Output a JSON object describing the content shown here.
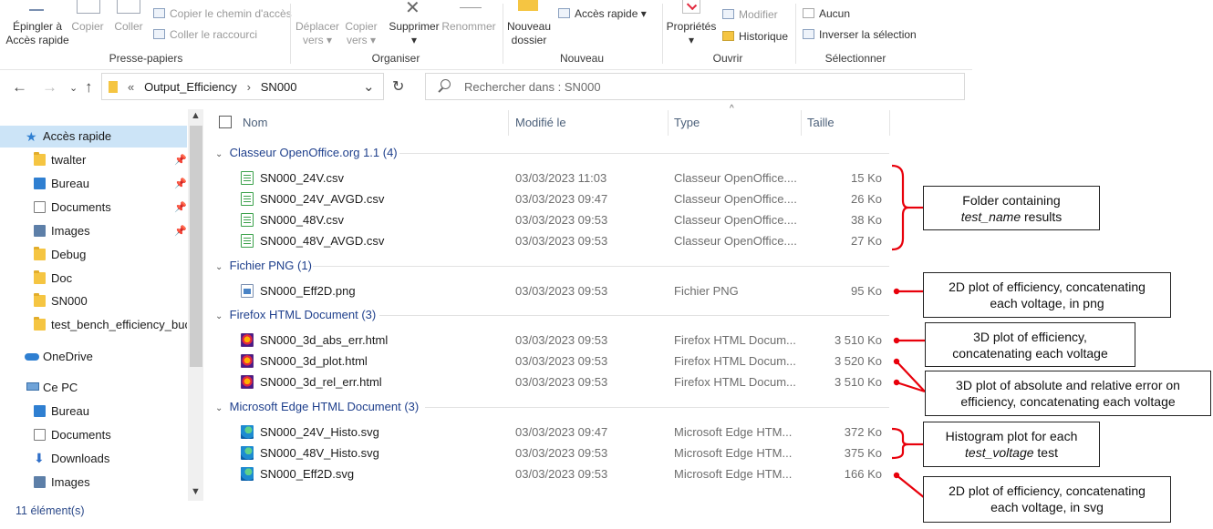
{
  "ribbon": {
    "clipboard": {
      "pin_label_1": "Épingler à",
      "pin_label_2": "Accès rapide",
      "copy": "Copier",
      "paste": "Coller",
      "copy_path": "Copier le chemin d'accès",
      "paste_shortcut": "Coller le raccourci",
      "group": "Presse-papiers"
    },
    "organize": {
      "move_1": "Déplacer",
      "move_2": "vers",
      "copy_1": "Copier",
      "copy_2": "vers",
      "delete": "Supprimer",
      "rename": "Renommer",
      "group": "Organiser"
    },
    "new": {
      "new_folder_1": "Nouveau",
      "new_folder_2": "dossier",
      "quick_access": "Accès rapide",
      "group": "Nouveau"
    },
    "open": {
      "properties": "Propriétés",
      "edit": "Modifier",
      "history": "Historique",
      "group": "Ouvrir"
    },
    "select": {
      "none": "Aucun",
      "invert": "Inverser la sélection",
      "group": "Sélectionner"
    }
  },
  "address": {
    "prefix": "«",
    "crumb1": "Output_Efficiency",
    "sep": "›",
    "crumb2": "SN000",
    "search_placeholder": "Rechercher dans : SN000"
  },
  "sidebar": {
    "quick_access": "Accès rapide",
    "items": [
      {
        "label": "twalter",
        "icon": "folder-icon",
        "pinned": true
      },
      {
        "label": "Bureau",
        "icon": "desktop-icon",
        "pinned": true
      },
      {
        "label": "Documents",
        "icon": "documents-icon",
        "pinned": true
      },
      {
        "label": "Images",
        "icon": "images-icon",
        "pinned": true
      },
      {
        "label": "Debug",
        "icon": "folder-icon",
        "pinned": false
      },
      {
        "label": "Doc",
        "icon": "folder-icon",
        "pinned": false
      },
      {
        "label": "SN000",
        "icon": "folder-icon",
        "pinned": false
      },
      {
        "label": "test_bench_efficiency_buck",
        "icon": "folder-icon",
        "pinned": false
      }
    ],
    "onedrive": "OneDrive",
    "this_pc": "Ce PC",
    "pc_items": [
      {
        "label": "Bureau",
        "icon": "desktop-icon"
      },
      {
        "label": "Documents",
        "icon": "documents-icon"
      },
      {
        "label": "Downloads",
        "icon": "downloads-icon"
      },
      {
        "label": "Images",
        "icon": "images-icon"
      }
    ]
  },
  "columns": {
    "name": "Nom",
    "modified": "Modifié le",
    "type": "Type",
    "size": "Taille"
  },
  "groups": [
    {
      "label": "Classeur OpenOffice.org 1.1 (4)",
      "icon": "csv-icon",
      "files": [
        {
          "name": "SN000_24V.csv",
          "date": "03/03/2023 11:03",
          "type": "Classeur OpenOffice....",
          "size": "15 Ko"
        },
        {
          "name": "SN000_24V_AVGD.csv",
          "date": "03/03/2023 09:47",
          "type": "Classeur OpenOffice....",
          "size": "26 Ko"
        },
        {
          "name": "SN000_48V.csv",
          "date": "03/03/2023 09:53",
          "type": "Classeur OpenOffice....",
          "size": "38 Ko"
        },
        {
          "name": "SN000_48V_AVGD.csv",
          "date": "03/03/2023 09:53",
          "type": "Classeur OpenOffice....",
          "size": "27 Ko"
        }
      ]
    },
    {
      "label": "Fichier PNG (1)",
      "icon": "png-icon",
      "files": [
        {
          "name": "SN000_Eff2D.png",
          "date": "03/03/2023 09:53",
          "type": "Fichier PNG",
          "size": "95 Ko"
        }
      ]
    },
    {
      "label": "Firefox HTML Document (3)",
      "icon": "firefox-icon",
      "files": [
        {
          "name": "SN000_3d_abs_err.html",
          "date": "03/03/2023 09:53",
          "type": "Firefox HTML Docum...",
          "size": "3 510 Ko"
        },
        {
          "name": "SN000_3d_plot.html",
          "date": "03/03/2023 09:53",
          "type": "Firefox HTML Docum...",
          "size": "3 520 Ko"
        },
        {
          "name": "SN000_3d_rel_err.html",
          "date": "03/03/2023 09:53",
          "type": "Firefox HTML Docum...",
          "size": "3 510 Ko"
        }
      ]
    },
    {
      "label": "Microsoft Edge HTML Document (3)",
      "icon": "edge-icon",
      "files": [
        {
          "name": "SN000_24V_Histo.svg",
          "date": "03/03/2023 09:47",
          "type": "Microsoft Edge HTM...",
          "size": "372 Ko"
        },
        {
          "name": "SN000_48V_Histo.svg",
          "date": "03/03/2023 09:53",
          "type": "Microsoft Edge HTM...",
          "size": "375 Ko"
        },
        {
          "name": "SN000_Eff2D.svg",
          "date": "03/03/2023 09:53",
          "type": "Microsoft Edge HTM...",
          "size": "166 Ko"
        }
      ]
    }
  ],
  "status": "11 élément(s)",
  "annotations": {
    "a1_line1": "Folder containing",
    "a1_italic": "test_name",
    "a1_rest": " results",
    "a2_line1": "2D plot of efficiency, concatenating",
    "a2_line2": "each voltage, in png",
    "a3_line1": "3D plot of efficiency,",
    "a3_line2": "concatenating each voltage",
    "a4_line1": "3D plot of absolute and relative error on",
    "a4_line2": "efficiency, concatenating each voltage",
    "a5_line1": "Histogram plot for each",
    "a5_italic": "test_voltage",
    "a5_rest": " test",
    "a6_line1": "2D plot of efficiency, concatenating",
    "a6_line2": "each voltage, in svg"
  },
  "colors": {
    "annotation_red": "#e8000b",
    "group_header_blue": "#1e3f8c",
    "selected_bg": "#cce4f7"
  }
}
